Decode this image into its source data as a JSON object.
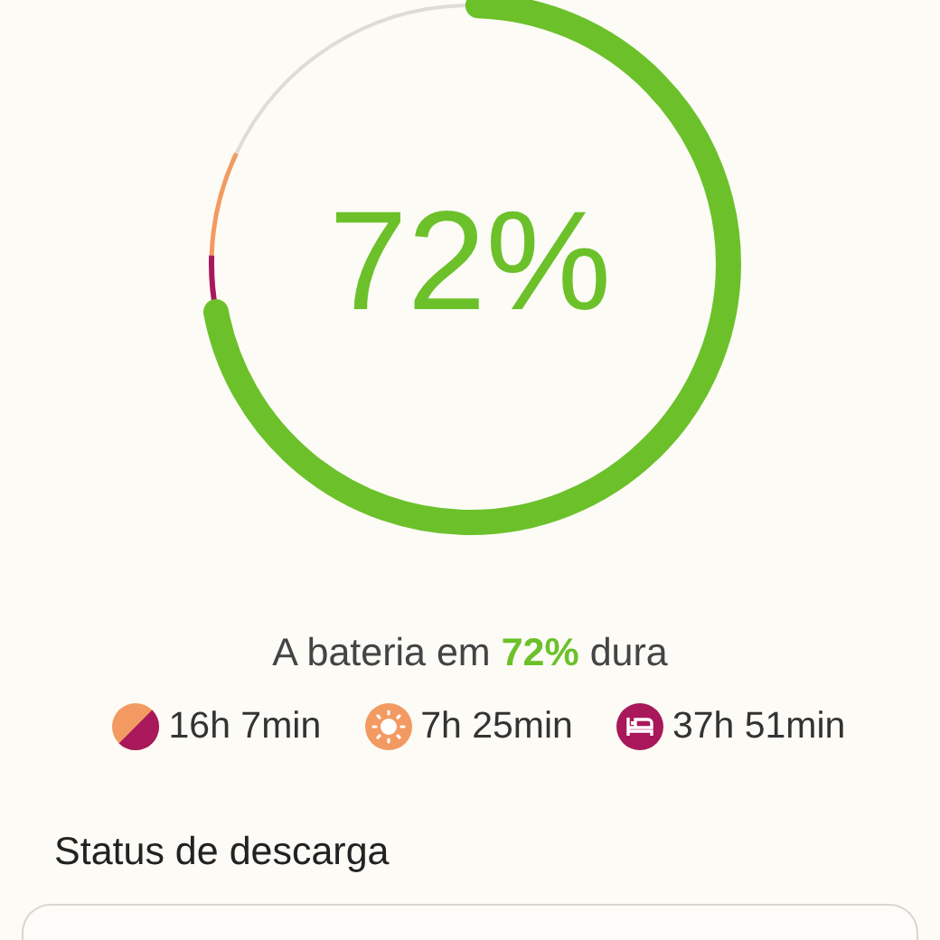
{
  "battery": {
    "percent_label": "72%",
    "level": 0.72
  },
  "summary": {
    "text": "A bateria em **72%** dura"
  },
  "estimates": [
    {
      "kind": "mixed",
      "label": "16h 7min",
      "color": "#f39a62"
    },
    {
      "kind": "sun",
      "label": "7h 25min",
      "color": "#f39a62"
    },
    {
      "kind": "sleep",
      "label": "37h 51min",
      "color": "#a8185a"
    }
  ],
  "section": {
    "title": "Status de descarga"
  }
}
